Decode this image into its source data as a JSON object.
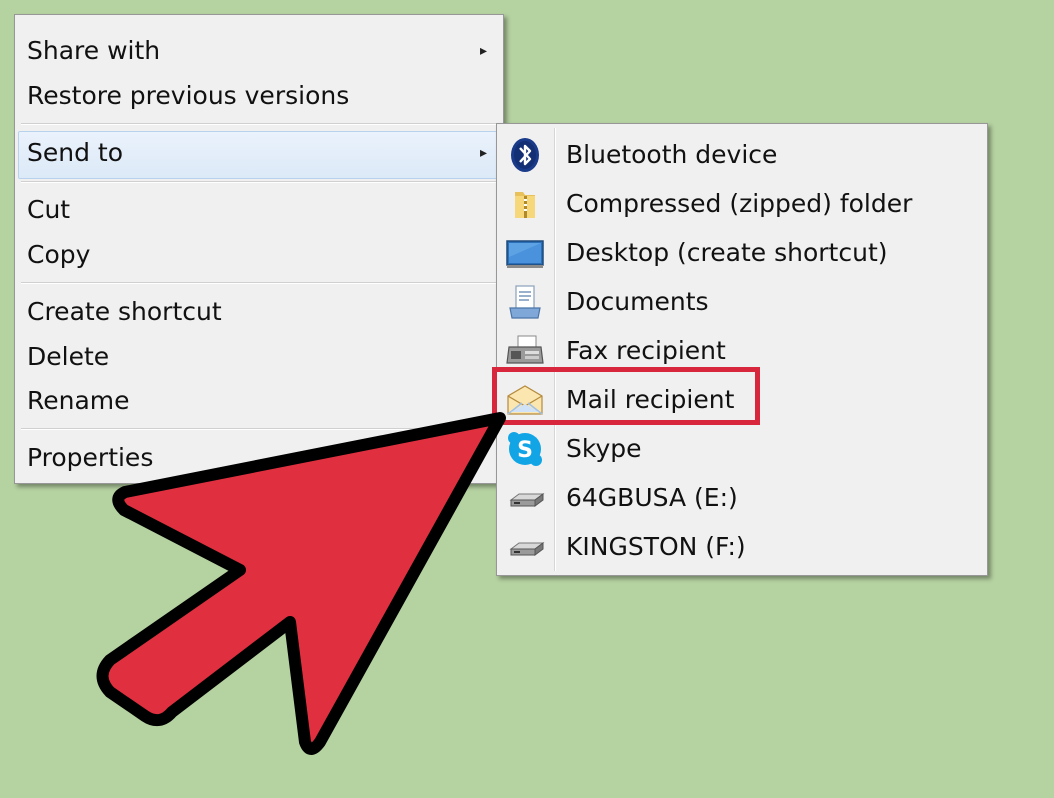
{
  "context_menu": {
    "items": [
      {
        "label": "Share with",
        "has_submenu": true
      },
      {
        "label": "Restore previous versions"
      },
      {
        "label": "Send to",
        "has_submenu": true,
        "highlighted": true
      },
      {
        "label": "Cut"
      },
      {
        "label": "Copy"
      },
      {
        "label": "Create shortcut"
      },
      {
        "label": "Delete"
      },
      {
        "label": "Rename"
      },
      {
        "label": "Properties"
      }
    ],
    "submenu_arrow": "▸"
  },
  "send_to_menu": {
    "items": [
      {
        "label": "Bluetooth device",
        "icon": "bluetooth-icon"
      },
      {
        "label": "Compressed (zipped) folder",
        "icon": "zip-folder-icon"
      },
      {
        "label": "Desktop (create shortcut)",
        "icon": "desktop-icon"
      },
      {
        "label": "Documents",
        "icon": "documents-icon"
      },
      {
        "label": "Fax recipient",
        "icon": "fax-icon"
      },
      {
        "label": "Mail recipient",
        "icon": "mail-icon",
        "highlighted": true
      },
      {
        "label": "Skype",
        "icon": "skype-icon"
      },
      {
        "label": "64GBUSA (E:)",
        "icon": "drive-icon"
      },
      {
        "label": "KINGSTON (F:)",
        "icon": "drive-icon"
      }
    ]
  },
  "colors": {
    "background": "#b5d2a1",
    "menu_bg": "#f0f0f0",
    "highlight_box": "#d8263c",
    "arrow_fill": "#e03040"
  }
}
